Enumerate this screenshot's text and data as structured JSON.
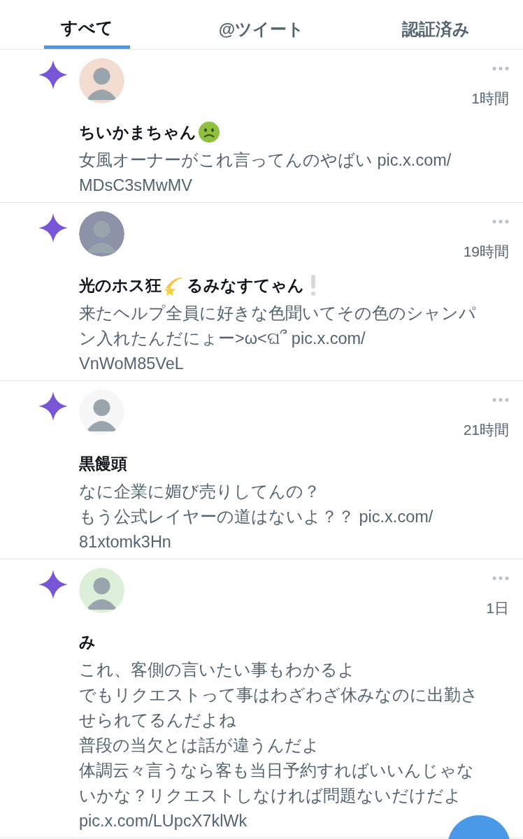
{
  "tabs": [
    {
      "label": "すべて",
      "selected": true
    },
    {
      "label": "@ツイート",
      "selected": false
    },
    {
      "label": "認証済み",
      "selected": false
    }
  ],
  "notifications": [
    {
      "avatar": {
        "color": "#f2ddd0"
      },
      "time": "1時間",
      "name": [
        {
          "kind": "text",
          "text": "ちいかまちゃん"
        },
        {
          "kind": "nauseated"
        }
      ],
      "lines": [
        "女風オーナーがこれ言ってんのやばい pic.x.com/",
        "MDsC3sMwMV"
      ]
    },
    {
      "avatar": {
        "color": "#8c93a8"
      },
      "time": "19時間",
      "name": [
        {
          "kind": "text",
          "text": "光のホス狂"
        },
        {
          "kind": "dizzy"
        },
        {
          "kind": "text",
          "text": "るみなすてゃん"
        },
        {
          "kind": "exclamation"
        }
      ],
      "lines": [
        "来たヘルプ全員に好きな色聞いてその色のシャンパ",
        "ン入れたんだにょー>ω<ଘ՞ pic.x.com/",
        "VnWoM85VeL"
      ]
    },
    {
      "avatar": {
        "color": "#f7f7f7"
      },
      "time": "21時間",
      "name": [
        {
          "kind": "text",
          "text": "黒饅頭"
        }
      ],
      "lines": [
        "なに企業に媚び売りしてんの？",
        "もう公式レイヤーの道はないよ？？ pic.x.com/",
        "81xtomk3Hn"
      ]
    },
    {
      "avatar": {
        "color": "#dcefd8"
      },
      "time": "1日",
      "name": [
        {
          "kind": "text",
          "text": "み"
        }
      ],
      "lines": [
        "これ、客側の言いたい事もわかるよ",
        "でもリクエストって事はわざわざ休みなのに出勤さ",
        "せられてるんだよね",
        "普段の当欠とは話が違うんだよ",
        "体調云々言うなら客も当日予約すればいいんじゃな",
        "いかな？リクエストしなければ問題ないだけだよ",
        "pic.x.com/LUpcX7klWk"
      ]
    }
  ]
}
